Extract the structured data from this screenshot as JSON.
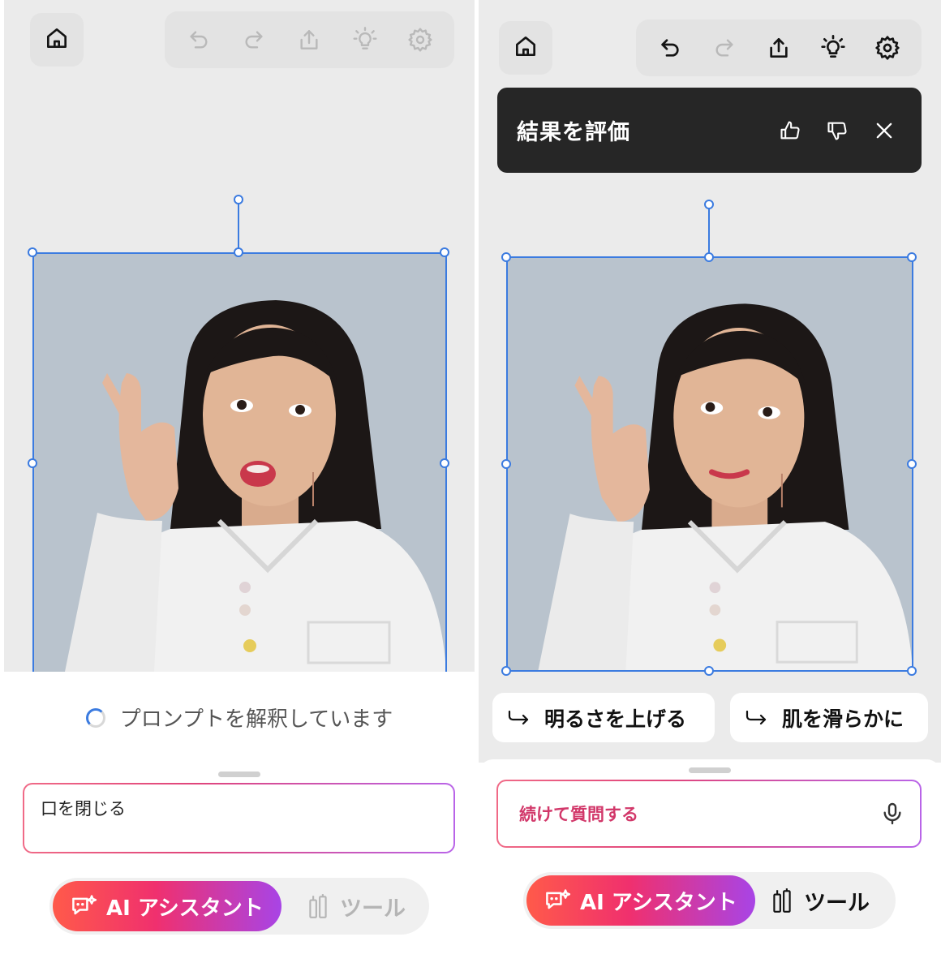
{
  "left": {
    "status_text": "プロンプトを解釈しています",
    "prompt_value": "口を閉じる",
    "mode": {
      "ai_label": "AI アシスタント",
      "tool_label": "ツール"
    }
  },
  "right": {
    "rating": {
      "title": "結果を評価"
    },
    "suggestions": [
      "明るさを上げる",
      "肌を滑らかに"
    ],
    "prompt_placeholder": "続けて質問する",
    "mode": {
      "ai_label": "AI アシスタント",
      "tool_label": "ツール"
    }
  },
  "icons": {
    "home": "home-icon",
    "undo": "undo-icon",
    "redo": "redo-icon",
    "share": "share-icon",
    "tips": "lightbulb-icon",
    "settings": "gear-icon",
    "thumbs_up": "thumbs-up-icon",
    "thumbs_down": "thumbs-down-icon",
    "close": "close-icon",
    "arrow": "return-arrow-icon",
    "mic": "mic-icon",
    "ai": "ai-chat-sparkle-icon",
    "tool": "tools-icon"
  },
  "colors": {
    "selection": "#3b7be0",
    "banner": "#262626",
    "accent_pink": "#e0457b",
    "accent_purple": "#a844e6"
  }
}
